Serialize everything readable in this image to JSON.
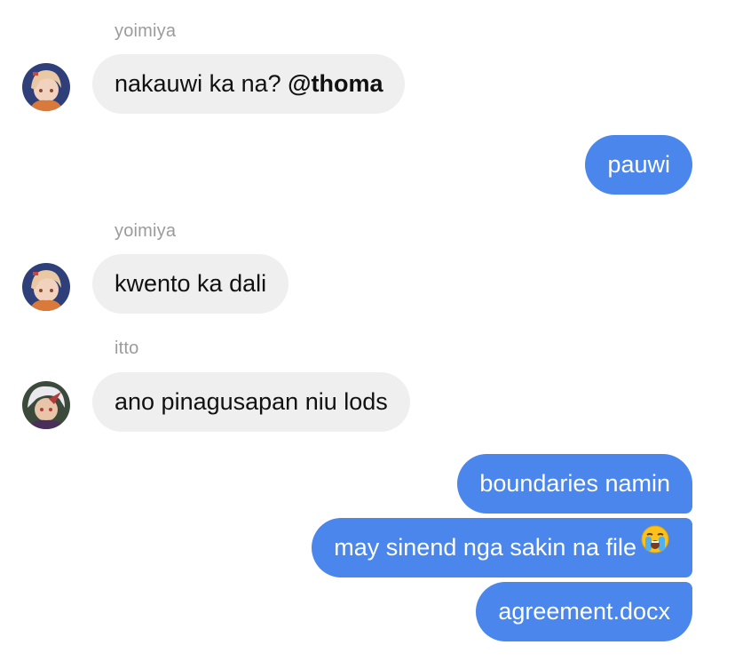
{
  "conversation": {
    "messages": [
      {
        "sender": "yoimiya",
        "text": "nakauwi ka na? ",
        "mention": "@thoma",
        "direction": "incoming"
      },
      {
        "text": "pauwi",
        "direction": "outgoing"
      },
      {
        "sender": "yoimiya",
        "text": "kwento ka dali",
        "direction": "incoming"
      },
      {
        "sender": "itto",
        "text": "ano pinagusapan niu lods",
        "direction": "incoming"
      },
      {
        "text": "boundaries namin",
        "direction": "outgoing"
      },
      {
        "text": "may sinend nga sakin na file",
        "emoji": "loudly-crying-face-icon",
        "direction": "outgoing"
      },
      {
        "text": "agreement.docx",
        "direction": "outgoing"
      }
    ]
  },
  "colors": {
    "outgoing_bubble": "#4a86ec",
    "incoming_bubble": "#efefef",
    "sender_name": "#9b9b9b"
  }
}
